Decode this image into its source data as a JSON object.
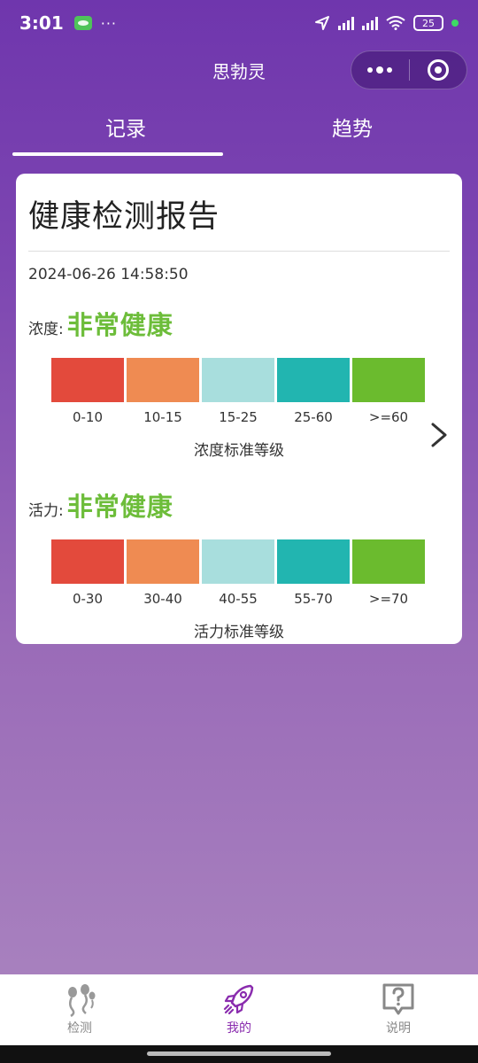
{
  "status_bar": {
    "time": "3:01",
    "battery": "25"
  },
  "nav": {
    "title": "思勃灵"
  },
  "tabs": [
    {
      "label": "记录"
    },
    {
      "label": "趋势"
    }
  ],
  "report": {
    "title": "健康检测报告",
    "datetime": "2024-06-26 14:58:50",
    "concentration": {
      "label": "浓度:",
      "value": "非常健康",
      "scale": [
        "0-10",
        "10-15",
        "15-25",
        "25-60",
        ">=60"
      ],
      "caption": "浓度标准等级"
    },
    "vitality": {
      "label": "活力:",
      "value": "非常健康",
      "scale": [
        "0-30",
        "30-40",
        "40-55",
        "55-70",
        ">=70"
      ],
      "caption": "活力标准等级"
    },
    "scale_colors": [
      "#e34a3c",
      "#ef8b52",
      "#a8dedd",
      "#22b5b0",
      "#6bbb2e"
    ]
  },
  "tabbar": [
    {
      "label": "检测",
      "icon": "sperm-icon"
    },
    {
      "label": "我的",
      "icon": "rocket-icon"
    },
    {
      "label": "说明",
      "icon": "help-icon"
    }
  ]
}
